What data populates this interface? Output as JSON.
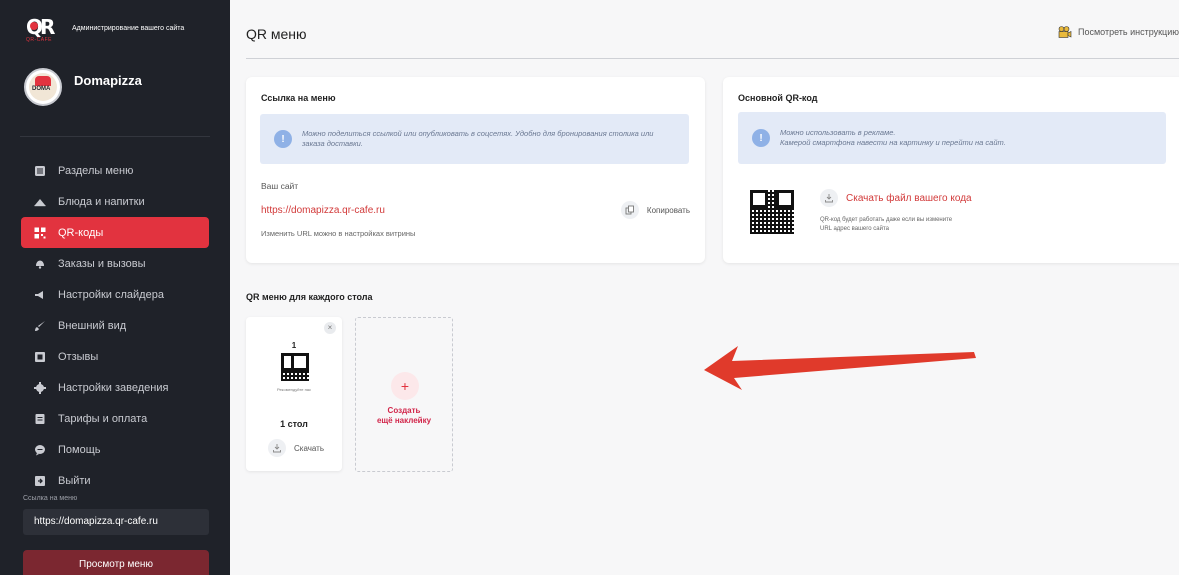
{
  "sidebar": {
    "logo_letters": "QR",
    "logo_sub": "QR-CAFE",
    "admin_title": "Администрирование вашего сайта",
    "brand_name": "Domapizza",
    "items": [
      {
        "label": "Разделы меню",
        "icon": "list-icon"
      },
      {
        "label": "Блюда и напитки",
        "icon": "dish-icon"
      },
      {
        "label": "QR-коды",
        "icon": "qr-icon",
        "active": true
      },
      {
        "label": "Заказы и вызовы",
        "icon": "bell-icon"
      },
      {
        "label": "Настройки слайдера",
        "icon": "megaphone-icon"
      },
      {
        "label": "Внешний вид",
        "icon": "brush-icon"
      },
      {
        "label": "Отзывы",
        "icon": "review-icon"
      },
      {
        "label": "Настройки заведения",
        "icon": "gear-icon"
      },
      {
        "label": "Тарифы и оплата",
        "icon": "wallet-icon"
      },
      {
        "label": "Помощь",
        "icon": "chat-icon"
      },
      {
        "label": "Выйти",
        "icon": "logout-icon"
      }
    ],
    "menu_link_label": "Ссылка на меню",
    "menu_link_value": "https://domapizza.qr-cafe.ru",
    "view_menu_button": "Просмотр меню"
  },
  "header": {
    "title": "QR меню",
    "instructions_link": "Посмотреть инструкцию"
  },
  "menu_link_card": {
    "title": "Ссылка на меню",
    "info": "Можно поделиться ссылкой или опубликовать в соцсетях. Удобно для бронирования столика или заказа доставки.",
    "site_label": "Ваш сайт",
    "site_url": "https://domapizza.qr-cafe.ru",
    "copy_label": "Копировать",
    "note": "Изменить URL можно в настройках витрины"
  },
  "main_qr_card": {
    "title": "Основной QR-код",
    "info_line1": "Можно использовать в рекламе.",
    "info_line2": "Камерой смартфона навести на картинку и перейти на сайт.",
    "download_label": "Скачать файл вашего кода",
    "note_line1": "QR-код будет работать даже если вы измените",
    "note_line2": "URL адрес вашего сайта"
  },
  "tables_section": {
    "title": "QR меню для каждого стола",
    "tables": [
      {
        "number": "1",
        "name": "1 стол",
        "qr_caption": "Рекомендуйте нас",
        "download_label": "Скачать",
        "close": "×"
      }
    ],
    "add_plus": "+",
    "add_line1": "Создать",
    "add_line2": "ещё наклейку"
  },
  "colors": {
    "sidebar_bg": "#1f2229",
    "accent": "#e2333f",
    "link": "#d23a3a",
    "info_bg": "#e3eaf7"
  }
}
